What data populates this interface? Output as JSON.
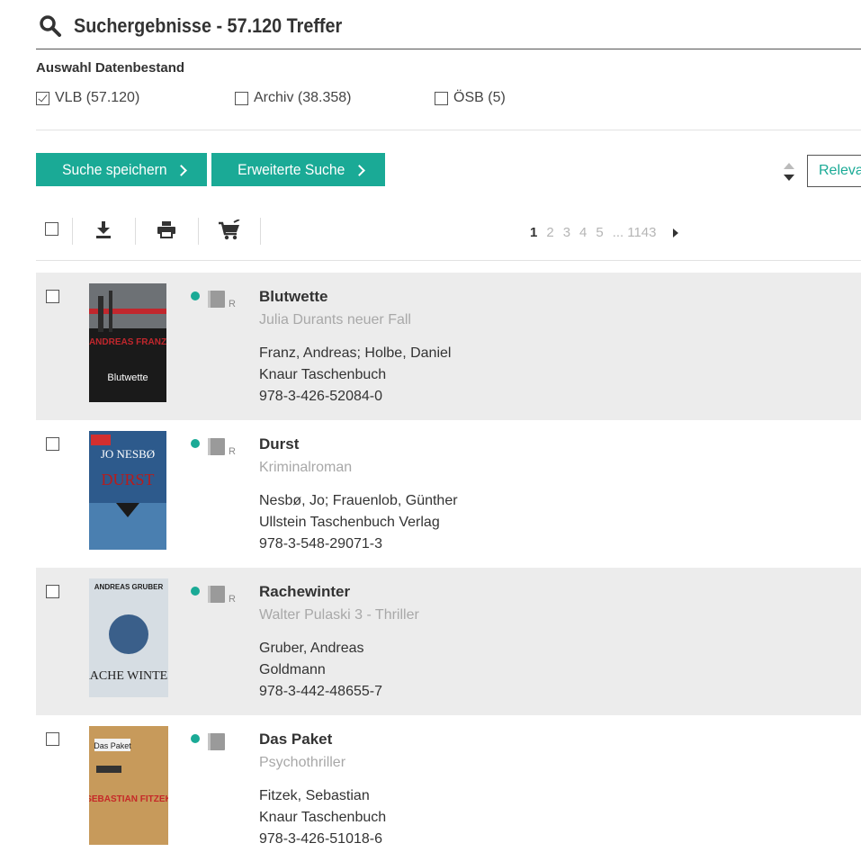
{
  "header": {
    "title": "Suchergebnisse - 57.120 Treffer"
  },
  "datasets": {
    "label": "Auswahl Datenbestand",
    "options": [
      {
        "label": "VLB (57.120)",
        "checked": true
      },
      {
        "label": "Archiv (38.358)",
        "checked": false
      },
      {
        "label": "ÖSB (5)",
        "checked": false
      }
    ]
  },
  "actions": {
    "save": "Suche speichern",
    "advanced": "Erweiterte Suche"
  },
  "sort": {
    "value": "Relevanz"
  },
  "toolbar": {
    "icons": [
      "checkbox",
      "download-icon",
      "print-icon",
      "cart-icon"
    ]
  },
  "pagination": {
    "current": "1",
    "pages": [
      "2",
      "3",
      "4",
      "5"
    ],
    "ellipsis": "...",
    "last": "1143"
  },
  "results": [
    {
      "title": "Blutwette",
      "subtitle": "Julia Durants neuer Fall",
      "authors": "Franz, Andreas; Holbe, Daniel",
      "publisher": "Knaur Taschenbuch",
      "isbn": "978-3-426-52084-0",
      "mark": "R",
      "cover": {
        "author": "ANDREAS FRANZ",
        "title": "Blutwette"
      }
    },
    {
      "title": "Durst",
      "subtitle": "Kriminalroman",
      "authors": "Nesbø, Jo; Frauenlob, Günther",
      "publisher": "Ullstein Taschenbuch Verlag",
      "isbn": "978-3-548-29071-3",
      "mark": "R",
      "cover": {
        "author": "JO NESBØ",
        "title": "DURST"
      }
    },
    {
      "title": "Rachewinter",
      "subtitle": "Walter Pulaski 3 - Thriller",
      "authors": "Gruber, Andreas",
      "publisher": "Goldmann",
      "isbn": "978-3-442-48655-7",
      "mark": "R",
      "cover": {
        "author": "ANDREAS GRUBER",
        "title": "RACHE WINTER"
      }
    },
    {
      "title": "Das Paket",
      "subtitle": "Psychothriller",
      "authors": "Fitzek, Sebastian",
      "publisher": "Knaur Taschenbuch",
      "isbn": "978-3-426-51018-6",
      "mark": "",
      "cover": {
        "author": "SEBASTIAN FITZEK",
        "title": "Das Paket"
      }
    }
  ],
  "colors": {
    "accent": "#1aaa96",
    "row_shade": "#ececec"
  }
}
